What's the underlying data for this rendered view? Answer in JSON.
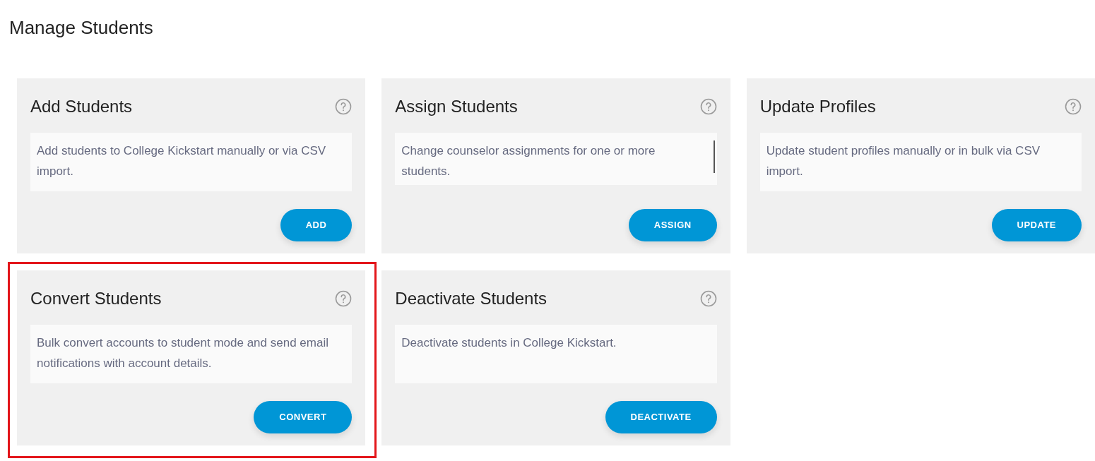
{
  "page_title": "Manage Students",
  "cards": [
    {
      "title": "Add Students",
      "description": "Add students to College Kickstart manually or via CSV import.",
      "button": "ADD",
      "highlighted": false,
      "scrollable": false
    },
    {
      "title": "Assign Students",
      "description": "Change counselor assignments for one or more students.",
      "button": "ASSIGN",
      "highlighted": false,
      "scrollable": true
    },
    {
      "title": "Update Profiles",
      "description": "Update student profiles manually or in bulk via CSV import.",
      "button": "UPDATE",
      "highlighted": false,
      "scrollable": false
    },
    {
      "title": "Convert Students",
      "description": "Bulk convert accounts to student mode and send email notifications with account details.",
      "button": "CONVERT",
      "highlighted": true,
      "scrollable": false
    },
    {
      "title": "Deactivate Students",
      "description": "Deactivate students in College Kickstart.",
      "button": "DEACTIVATE",
      "highlighted": false,
      "scrollable": false
    }
  ]
}
